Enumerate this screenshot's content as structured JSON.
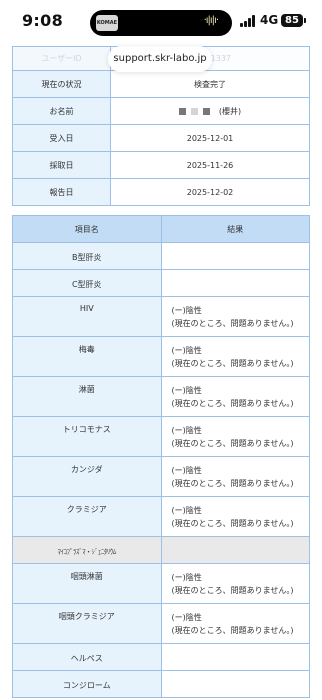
{
  "status_bar": {
    "time": "9:08",
    "island_app": "KOMAE",
    "network": "4G",
    "battery": "85"
  },
  "browser": {
    "url": "support.skr-labo.jp"
  },
  "patient_info": {
    "user_id_label": "ユーザーID",
    "user_id_value": "1337",
    "rows": [
      {
        "label": "現在の状況",
        "value": "検査完了"
      },
      {
        "label": "お名前",
        "value": "(櫻井)"
      },
      {
        "label": "受入日",
        "value": "2025-12-01"
      },
      {
        "label": "採取日",
        "value": "2025-11-26"
      },
      {
        "label": "報告日",
        "value": "2025-12-02"
      }
    ]
  },
  "results": {
    "header": {
      "item": "項目名",
      "result": "結果"
    },
    "rows": [
      {
        "item": "B型肝炎",
        "line1": "",
        "line2": ""
      },
      {
        "item": "C型肝炎",
        "line1": "",
        "line2": ""
      },
      {
        "item": "HIV",
        "line1": "(ー)陰性",
        "line2": "(現在のところ、問題ありません。)"
      },
      {
        "item": "梅毒",
        "line1": "(ー)陰性",
        "line2": "(現在のところ、問題ありません。)"
      },
      {
        "item": "淋菌",
        "line1": "(ー)陰性",
        "line2": "(現在のところ、問題ありません。)"
      },
      {
        "item": "トリコモナス",
        "line1": "(ー)陰性",
        "line2": "(現在のところ、問題ありません。)"
      },
      {
        "item": "カンジダ",
        "line1": "(ー)陰性",
        "line2": "(現在のところ、問題ありません。)"
      },
      {
        "item": "クラミジア",
        "line1": "(ー)陰性",
        "line2": "(現在のところ、問題ありません。)"
      },
      {
        "item": "ﾏｲｺﾌﾟﾗｽﾞﾏ・ｼﾞｪﾆﾀﾘｳﾑ",
        "line1": "",
        "line2": ""
      },
      {
        "item": "咽頭淋菌",
        "line1": "(ー)陰性",
        "line2": "(現在のところ、問題ありません。)"
      },
      {
        "item": "咽頭クラミジア",
        "line1": "(ー)陰性",
        "line2": "(現在のところ、問題ありません。)"
      },
      {
        "item": "ヘルペス",
        "line1": "",
        "line2": ""
      },
      {
        "item": "コンジローム",
        "line1": "",
        "line2": ""
      }
    ]
  }
}
